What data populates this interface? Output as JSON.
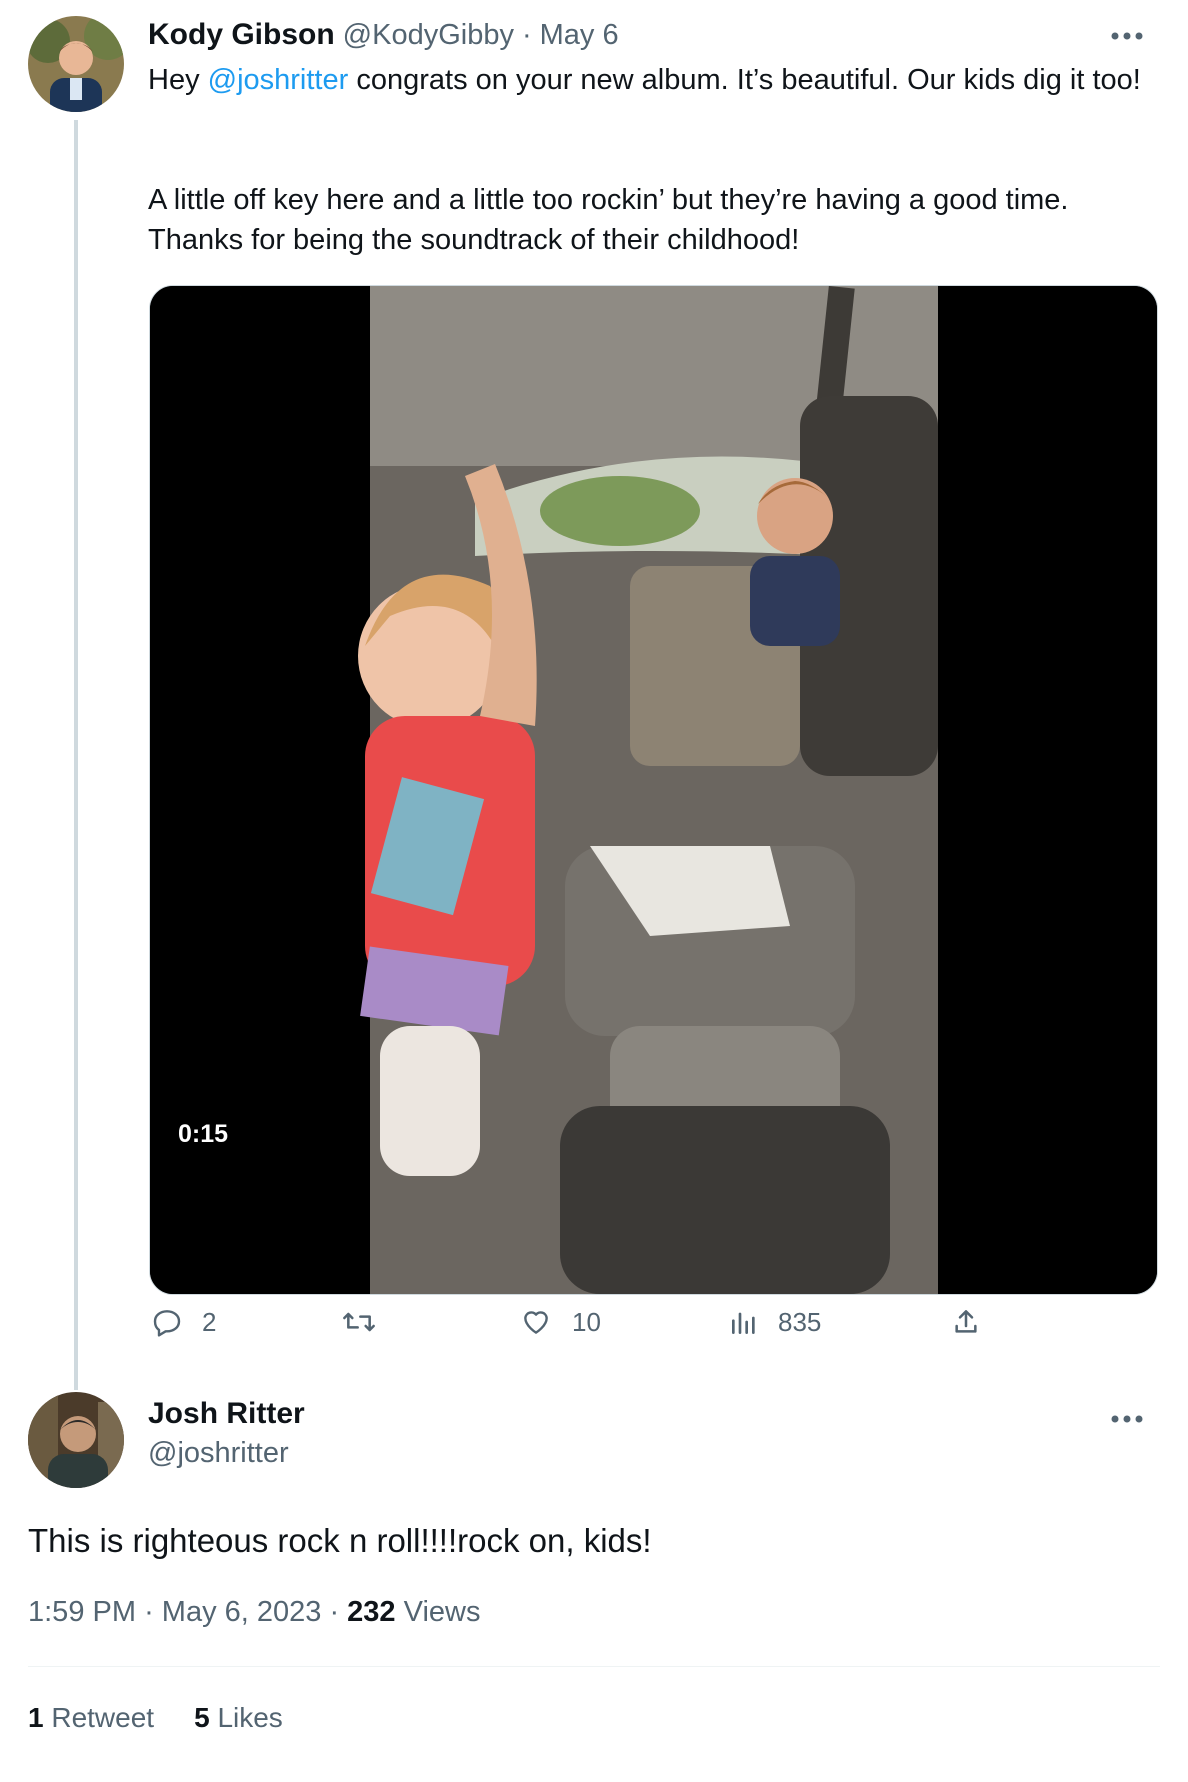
{
  "tweet": {
    "author_name": "Kody Gibson",
    "handle": "@KodyGibby",
    "date": "May 6",
    "text_pre": "Hey ",
    "mention": "@joshritter",
    "text_post": " congrats on your new album. It’s beautiful. Our kids dig it too!",
    "text_line2": "A little off key here and a little too rockin’ but they’re having a good time.",
    "text_line3": "Thanks for being the soundtrack of their childhood!",
    "video_duration": "0:15",
    "more_icon": "more-icon",
    "actions": {
      "replies": "2",
      "retweets": "",
      "likes": "10",
      "views": "835"
    }
  },
  "reply": {
    "author_name": "Josh Ritter",
    "handle": "@joshritter",
    "text": "This is righteous rock n roll!!!!rock on, kids!",
    "time": "1:59 PM",
    "date": "May 6, 2023",
    "views_count": "232",
    "views_label": "Views",
    "retweet_count": "1",
    "retweet_label": "Retweet",
    "likes_count": "5",
    "likes_label": "Likes"
  },
  "colors": {
    "accent": "#1d9bf0",
    "muted": "#536471",
    "divider": "#eff3f4"
  }
}
